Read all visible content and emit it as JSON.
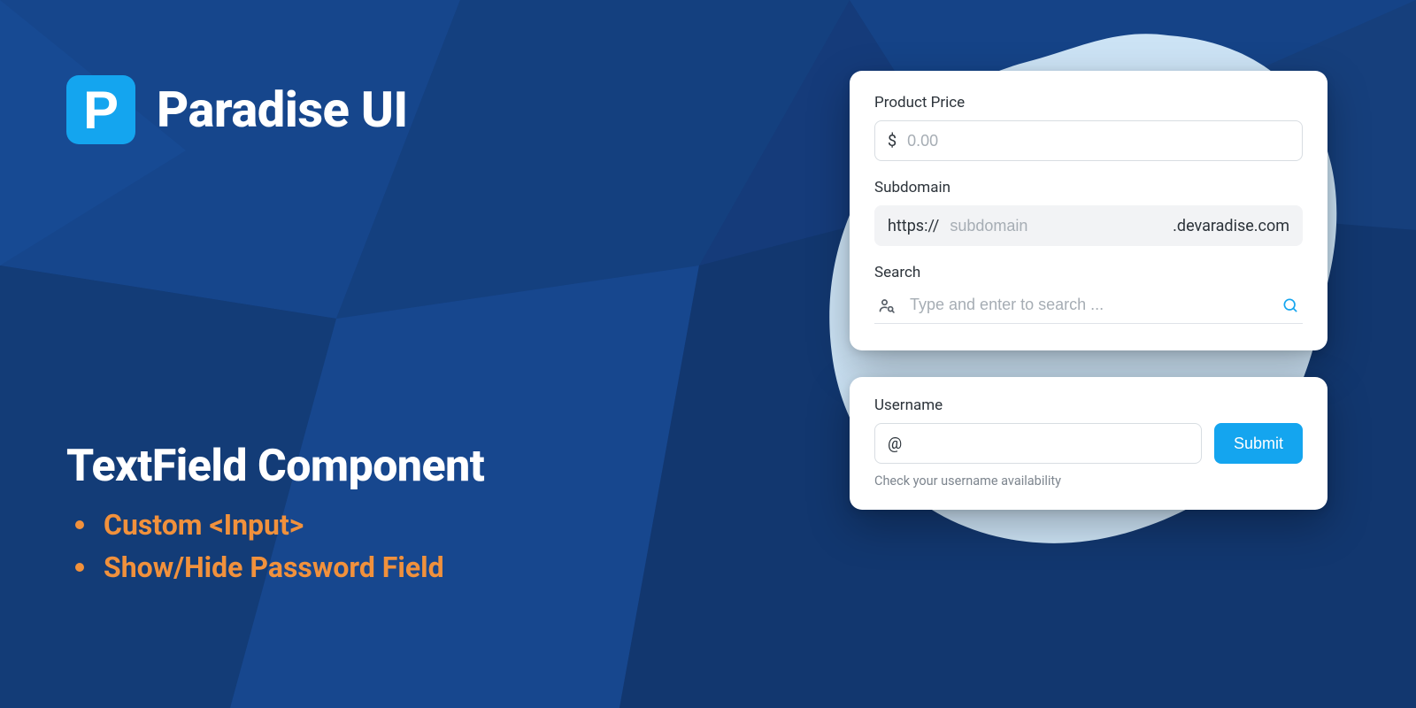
{
  "brand": {
    "logo_letter": "P",
    "name": "Paradise UI"
  },
  "heading": "TextField Component",
  "bullets": [
    "Custom <Input>",
    "Show/Hide Password Field"
  ],
  "card1": {
    "price": {
      "label": "Product Price",
      "prefix": "$",
      "placeholder": "0.00",
      "value": ""
    },
    "subdomain": {
      "label": "Subdomain",
      "prefix": "https://",
      "placeholder": "subdomain",
      "suffix": ".devaradise.com",
      "value": ""
    },
    "search": {
      "label": "Search",
      "placeholder": "Type and enter to search ...",
      "value": ""
    }
  },
  "card2": {
    "username": {
      "label": "Username",
      "prefix": "@",
      "value": "",
      "helper": "Check your username availability"
    },
    "submit_label": "Submit"
  },
  "colors": {
    "accent": "#14a5ef",
    "orange": "#f1913c",
    "bg_dark": "#153b7a"
  }
}
